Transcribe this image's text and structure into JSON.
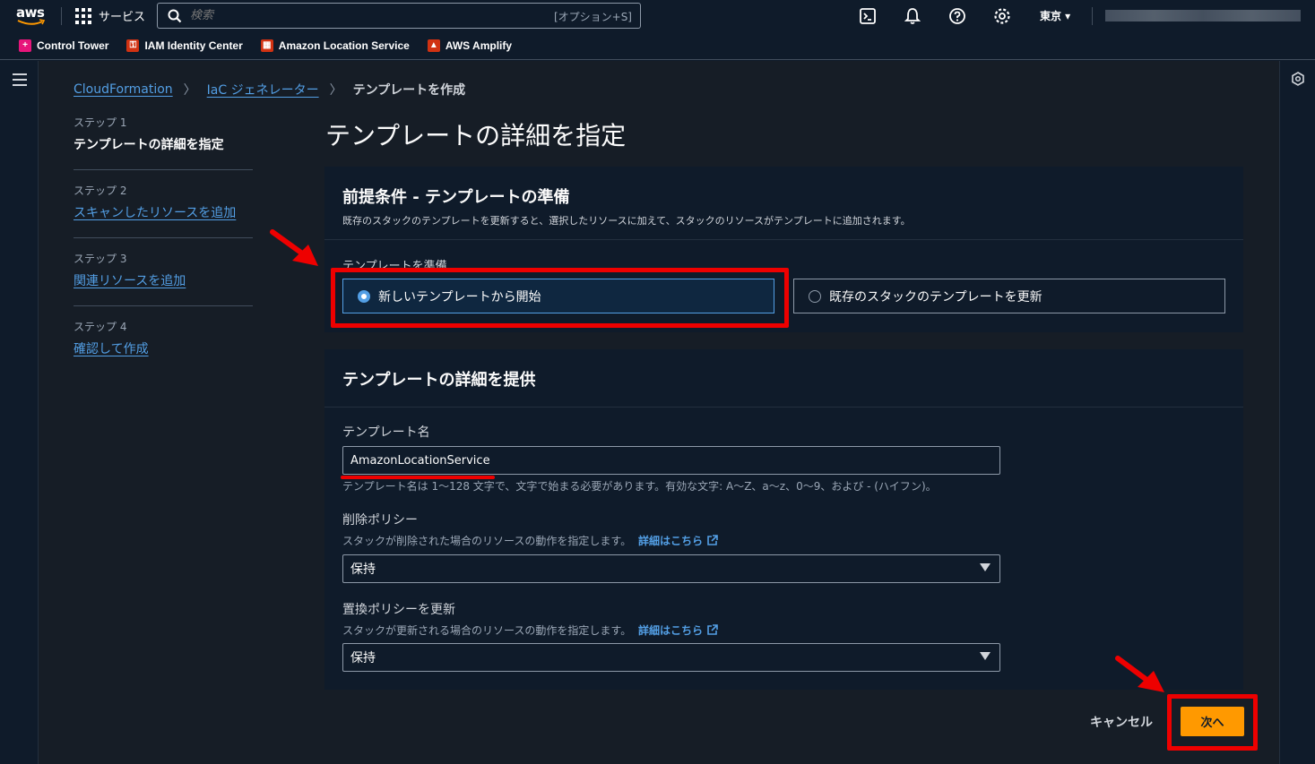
{
  "topnav": {
    "logo_text": "aws",
    "services_label": "サービス",
    "search_placeholder": "検索",
    "search_shortcut": "[オプション+S]",
    "region": "東京 ▾"
  },
  "favorites": [
    {
      "label": "Control Tower",
      "color": "#e7157b"
    },
    {
      "label": "IAM Identity Center",
      "color": "#d13212"
    },
    {
      "label": "Amazon Location Service",
      "color": "#d13212"
    },
    {
      "label": "AWS Amplify",
      "color": "#d13212"
    }
  ],
  "breadcrumb": {
    "items": [
      "CloudFormation",
      "IaC ジェネレーター"
    ],
    "current": "テンプレートを作成"
  },
  "steps": [
    {
      "num": "ステップ 1",
      "label": "テンプレートの詳細を指定"
    },
    {
      "num": "ステップ 2",
      "label": "スキャンしたリソースを追加"
    },
    {
      "num": "ステップ 3",
      "label": "関連リソースを追加"
    },
    {
      "num": "ステップ 4",
      "label": "確認して作成"
    }
  ],
  "page_title": "テンプレートの詳細を指定",
  "panel1": {
    "title": "前提条件 - テンプレートの準備",
    "description": "既存のスタックのテンプレートを更新すると、選択したリソースに加えて、スタックのリソースがテンプレートに追加されます。",
    "tiles_label": "テンプレートを準備",
    "option_new": "新しいテンプレートから開始",
    "option_existing": "既存のスタックのテンプレートを更新"
  },
  "panel2": {
    "title": "テンプレートの詳細を提供",
    "name_label": "テンプレート名",
    "name_value": "AmazonLocationService",
    "name_hint": "テンプレート名は 1〜128 文字で、文字で始まる必要があります。有効な文字: A〜Z、a〜z、0〜9、および - (ハイフン)。",
    "delete_label": "削除ポリシー",
    "delete_hint": "スタックが削除された場合のリソースの動作を指定します。",
    "delete_value": "保持",
    "replace_label": "置換ポリシーを更新",
    "replace_hint": "スタックが更新される場合のリソースの動作を指定します。",
    "replace_value": "保持",
    "details_link": "詳細はこちら"
  },
  "actions": {
    "cancel": "キャンセル",
    "next": "次へ"
  },
  "colors": {
    "accent_link": "#539fe5",
    "primary_button": "#ff9900",
    "annotation": "#ee0000"
  }
}
